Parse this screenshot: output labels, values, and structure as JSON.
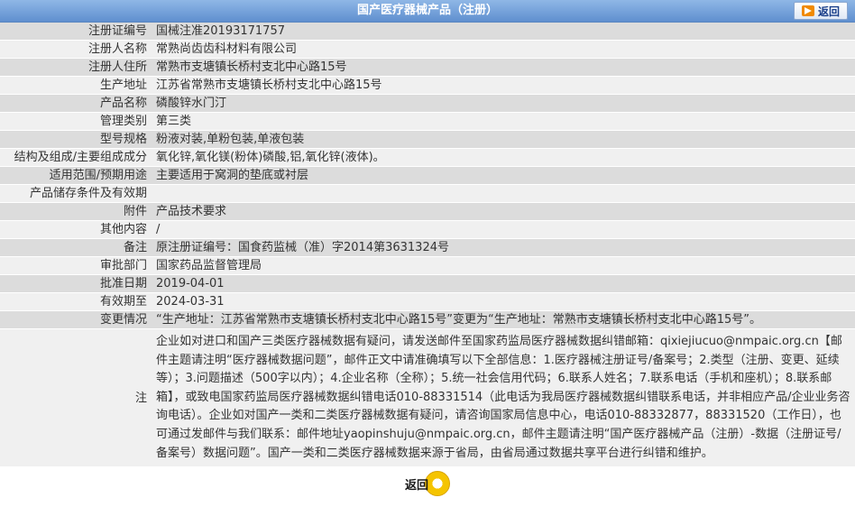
{
  "header": {
    "title": "国产医疗器械产品（注册）",
    "back_label": "返回"
  },
  "fields": [
    {
      "label": "注册证编号",
      "value": "国械注准20193171757"
    },
    {
      "label": "注册人名称",
      "value": "常熟尚齿齿科材料有限公司"
    },
    {
      "label": "注册人住所",
      "value": "常熟市支塘镇长桥村支北中心路15号"
    },
    {
      "label": "生产地址",
      "value": "江苏省常熟市支塘镇长桥村支北中心路15号"
    },
    {
      "label": "产品名称",
      "value": "磷酸锌水门汀"
    },
    {
      "label": "管理类别",
      "value": "第三类"
    },
    {
      "label": "型号规格",
      "value": "粉液对装,单粉包装,单液包装"
    },
    {
      "label": "结构及组成/主要组成成分",
      "value": "氧化锌,氧化镁(粉体)磷酸,铝,氧化锌(液体)。"
    },
    {
      "label": "适用范围/预期用途",
      "value": "主要适用于窝洞的垫底或衬层"
    },
    {
      "label": "产品储存条件及有效期",
      "value": ""
    },
    {
      "label": "附件",
      "value": "产品技术要求"
    },
    {
      "label": "其他内容",
      "value": "/"
    },
    {
      "label": "备注",
      "value": "原注册证编号：国食药监械（准）字2014第3631324号"
    },
    {
      "label": "审批部门",
      "value": "国家药品监督管理局"
    },
    {
      "label": "批准日期",
      "value": "2019-04-01"
    },
    {
      "label": "有效期至",
      "value": "2024-03-31"
    },
    {
      "label": "变更情况",
      "value": "“生产地址：江苏省常熟市支塘镇长桥村支北中心路15号”变更为“生产地址：常熟市支塘镇长桥村支北中心路15号”。"
    }
  ],
  "note": {
    "label": "注",
    "text": "企业如对进口和国产三类医疗器械数据有疑问，请发送邮件至国家药监局医疗器械数据纠错邮箱：qixiejiucuo@nmpaic.org.cn【邮件主题请注明“医疗器械数据问题”，邮件正文中请准确填写以下全部信息：1.医疗器械注册证号/备案号；2.类型（注册、变更、延续等）；3.问题描述（500字以内）；4.企业名称（全称）；5.统一社会信用代码；6.联系人姓名；7.联系电话（手机和座机）；8.联系邮箱】，或致电国家药监局医疗器械数据纠错电话010-88331514（此电话为我局医疗器械数据纠错联系电话，并非相应产品/企业业务咨询电话）。企业如对国产一类和二类医疗器械数据有疑问，请咨询国家局信息中心，电话010-88332877，88331520（工作日），也可通过发邮件与我们联系：邮件地址yaopinshuju@nmpaic.org.cn，邮件主题请注明“国产医疗器械产品（注册）-数据（注册证号/备案号）数据问题”。国产一类和二类医疗器械数据来源于省局，由省局通过数据共享平台进行纠错和维护。"
  },
  "footer": {
    "back_label": "返回"
  }
}
